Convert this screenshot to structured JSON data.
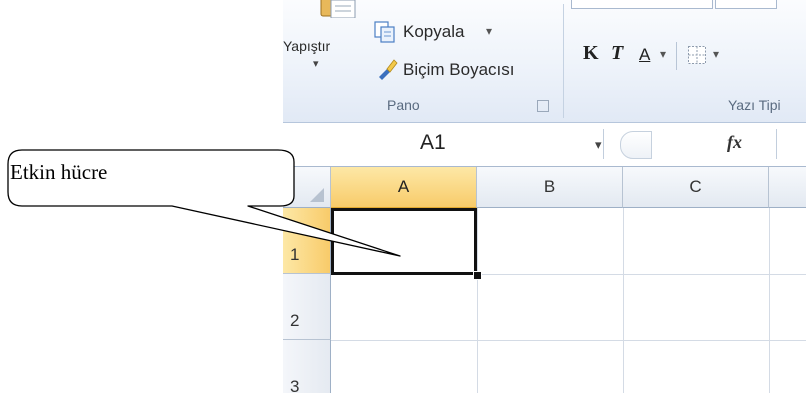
{
  "ribbon": {
    "paste_label": "Yapıştır",
    "copy_label": "Kopyala",
    "format_painter_label": "Biçim Boyacısı",
    "clipboard_group_label": "Pano",
    "font_group_label": "Yazı Tipi",
    "bold_label": "K",
    "italic_label": "T",
    "underline_label": "A",
    "dropdown_glyph": "▾"
  },
  "formula_bar": {
    "name_box_value": "A1",
    "fx_label": "fx",
    "formula_value": ""
  },
  "sheet": {
    "columns": [
      "A",
      "B",
      "C"
    ],
    "rows": [
      "1",
      "2",
      "3"
    ],
    "active_cell": "A1"
  },
  "callout": {
    "text": "Etkin hücre"
  },
  "colors": {
    "active_header": "#f8cb6a",
    "grid_line": "#d4dbe5",
    "ribbon_bg": "#e1e9f5"
  }
}
